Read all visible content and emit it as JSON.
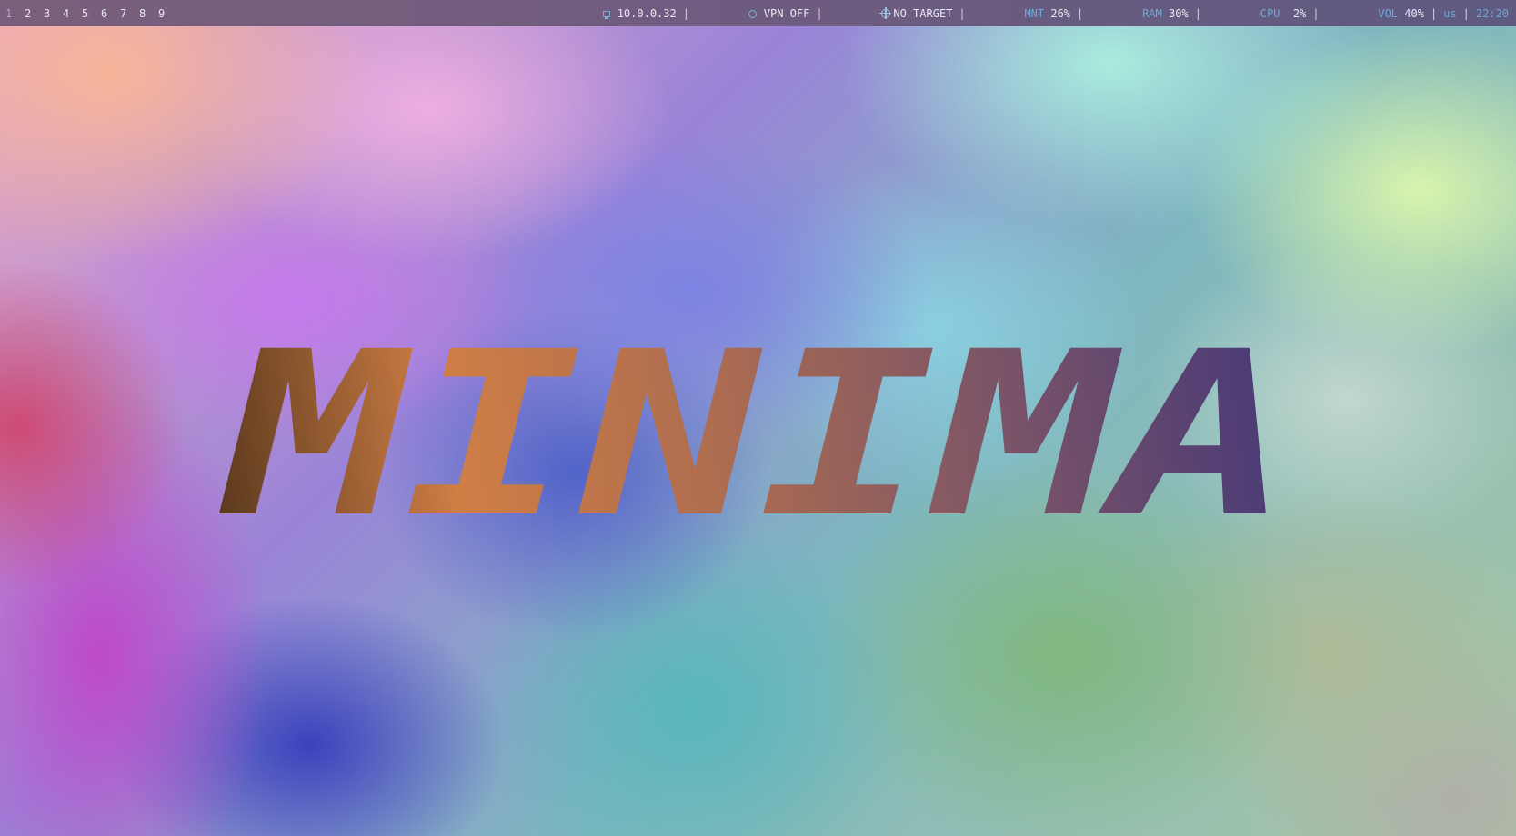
{
  "workspaces": [
    "1",
    "2",
    "3",
    "4",
    "5",
    "6",
    "7",
    "8",
    "9"
  ],
  "active_workspace": "1",
  "status": {
    "ip": "10.0.0.32",
    "vpn": "VPN OFF",
    "target": "NO TARGET",
    "mnt_label": "MNT",
    "mnt_value": "26%",
    "ram_label": "RAM",
    "ram_value": "30%",
    "cpu_label": "CPU",
    "cpu_value": "2%",
    "vol_label": "VOL",
    "vol_value": "40%",
    "keyboard_layout": "us",
    "clock": "22:20",
    "separator": "|"
  },
  "icons": {
    "ip": "monitor-icon",
    "vpn": "ring-icon",
    "target": "crosshair-icon"
  },
  "wallpaper": {
    "logo_text": "MINIMA",
    "logo_gradient": [
      "#5c3a1e",
      "#cf7e45",
      "#a8694e",
      "#7a5565",
      "#4a3a78"
    ]
  }
}
